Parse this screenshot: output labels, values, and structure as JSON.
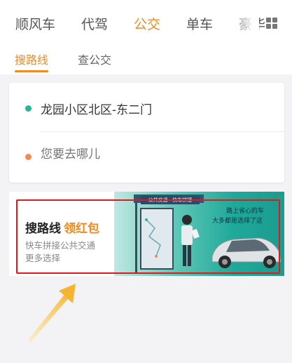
{
  "top_tabs": [
    {
      "label": "顺风车",
      "active": false
    },
    {
      "label": "代驾",
      "active": false
    },
    {
      "label": "公交",
      "active": true
    },
    {
      "label": "单车",
      "active": false
    },
    {
      "label": "豪华",
      "active": false
    }
  ],
  "sub_tabs": [
    {
      "label": "搜路线",
      "active": true
    },
    {
      "label": "查公交",
      "active": false
    }
  ],
  "route": {
    "origin": "龙园小区北区-东二门",
    "destination_placeholder": "您要去哪儿"
  },
  "banner": {
    "title": "搜路线",
    "title_accent": "领红包",
    "subtitle_line1": "快车拼接公共交通",
    "subtitle_line2": "更多选择",
    "sign_text": "公共交通 · 快车拼接",
    "slogan_line1": "路上省心的车",
    "slogan_line2": "大多都是选择了这"
  },
  "colors": {
    "accent": "#f08a24",
    "start_dot": "#2db593",
    "end_dot": "#f08a52",
    "highlight_box": "#e01a1a",
    "annotation_arrow": "#f5b532"
  },
  "icons": {
    "more_menu": "grid-icon"
  }
}
